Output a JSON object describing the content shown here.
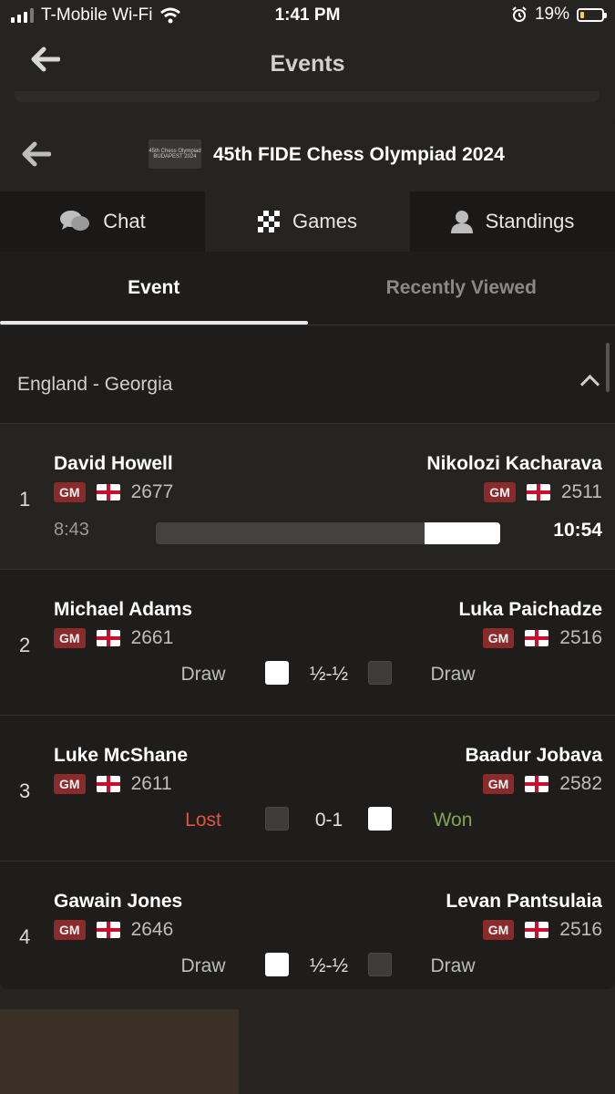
{
  "status_bar": {
    "carrier": "T-Mobile Wi-Fi",
    "time": "1:41 PM",
    "battery": "19%",
    "battery_level": 0.19
  },
  "header": {
    "title": "Events"
  },
  "event": {
    "title": "45th FIDE Chess Olympiad 2024",
    "logo_text_1": "45th Chess Olympiad",
    "logo_text_2": "BUDAPEST 2024"
  },
  "main_tabs": [
    {
      "label": "Chat",
      "icon": "chat-icon"
    },
    {
      "label": "Games",
      "icon": "checkerboard-icon"
    },
    {
      "label": "Standings",
      "icon": "person-icon"
    }
  ],
  "sub_tabs": [
    {
      "label": "Event",
      "active": true
    },
    {
      "label": "Recently Viewed",
      "active": false
    }
  ],
  "match": {
    "title": "England - Georgia"
  },
  "games": [
    {
      "board": "1",
      "white": {
        "name": "David Howell",
        "title": "GM",
        "rating": "2677",
        "flag": "england"
      },
      "black": {
        "name": "Nikolozi Kacharava",
        "title": "GM",
        "rating": "2511",
        "flag": "georgia"
      },
      "live": true,
      "white_clock": "8:43",
      "black_clock": "10:54",
      "black_eval_fraction": 0.22
    },
    {
      "board": "2",
      "white": {
        "name": "Michael Adams",
        "title": "GM",
        "rating": "2661",
        "flag": "england"
      },
      "black": {
        "name": "Luka Paichadze",
        "title": "GM",
        "rating": "2516",
        "flag": "georgia"
      },
      "white_result": "Draw",
      "score": "½-½",
      "black_result": "Draw"
    },
    {
      "board": "3",
      "white": {
        "name": "Luke McShane",
        "title": "GM",
        "rating": "2611",
        "flag": "england"
      },
      "black": {
        "name": "Baadur Jobava",
        "title": "GM",
        "rating": "2582",
        "flag": "georgia"
      },
      "white_result": "Lost",
      "score": "0-1",
      "black_result": "Won"
    },
    {
      "board": "4",
      "white": {
        "name": "Gawain Jones",
        "title": "GM",
        "rating": "2646",
        "flag": "england"
      },
      "black": {
        "name": "Levan Pantsulaia",
        "title": "GM",
        "rating": "2516",
        "flag": "georgia"
      },
      "white_result": "Draw",
      "score": "½-½",
      "black_result": "Draw"
    }
  ],
  "colors": {
    "background": "#262421",
    "panel": "#1e1d1b",
    "title_badge": "#8b2a2a",
    "lost": "#e0553f",
    "won": "#7fa650"
  }
}
